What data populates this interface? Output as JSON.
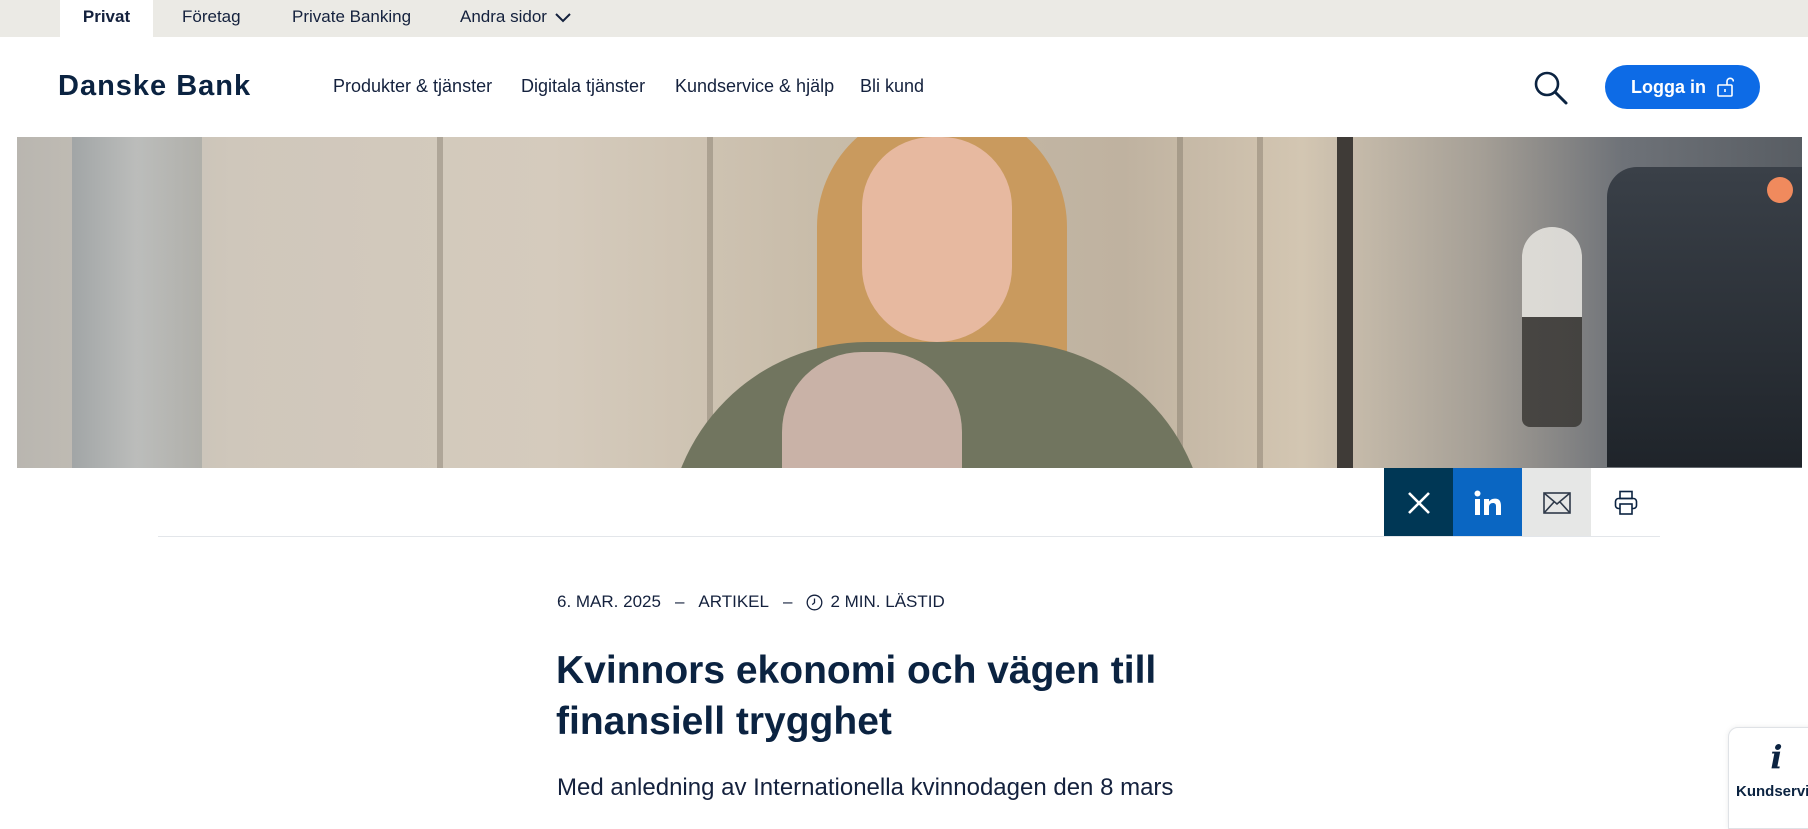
{
  "segments": {
    "privat": "Privat",
    "foretag": "Företag",
    "private_banking": "Private Banking",
    "other_pages": "Andra sidor"
  },
  "header": {
    "logo": "Danske Bank",
    "nav": [
      "Produkter & tjänster",
      "Digitala tjänster",
      "Kundservice & hjälp",
      "Bli kund"
    ],
    "login_label": "Logga in"
  },
  "article": {
    "date": "6. MAR. 2025",
    "type": "ARTIKEL",
    "read_time": "2 MIN. LÄSTID",
    "title": "Kvinnors ekonomi och vägen till finansiell trygghet",
    "lead": "Med anledning av Internationella kvinnodagen den 8 mars"
  },
  "widget": {
    "icon_glyph": "i",
    "label": "Kundservice"
  },
  "icons": {
    "search": "search-icon",
    "lock": "unlock-icon",
    "chevron": "chevron-down-icon",
    "share": [
      "x-icon",
      "linkedin-icon",
      "mail-icon",
      "print-icon"
    ],
    "clock": "clock-icon"
  },
  "colors": {
    "brand_navy": "#0b2341",
    "login_blue": "#0d6be6",
    "x_share": "#003755",
    "linkedin_share": "#0a66c2",
    "top_bar": "#ebeae5"
  }
}
